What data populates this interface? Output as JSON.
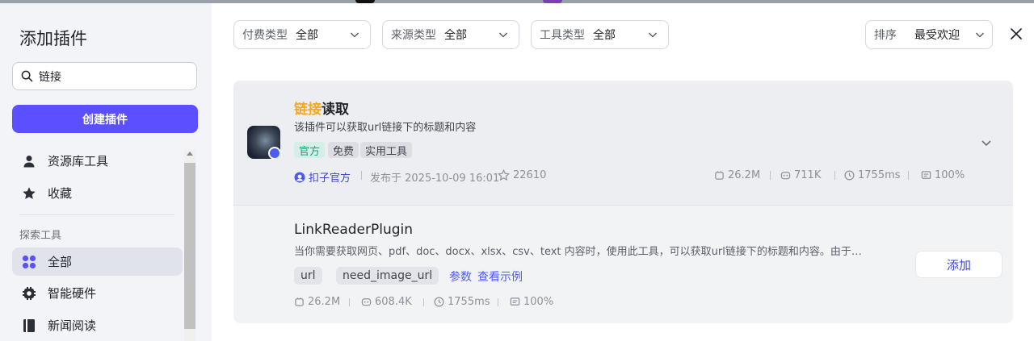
{
  "sidebar": {
    "title": "添加插件",
    "search": {
      "value": "链接",
      "placeholder": ""
    },
    "create_label": "创建插件",
    "top_items": [
      {
        "label": "资源库工具",
        "icon": "user-icon"
      },
      {
        "label": "收藏",
        "icon": "star-icon"
      }
    ],
    "section_label": "探索工具",
    "explore_items": [
      {
        "label": "全部",
        "icon": "grid-icon",
        "active": true
      },
      {
        "label": "智能硬件",
        "icon": "chip-icon",
        "active": false
      },
      {
        "label": "新闻阅读",
        "icon": "book-icon",
        "active": false
      }
    ]
  },
  "filters": [
    {
      "label": "付费类型",
      "value": "全部"
    },
    {
      "label": "来源类型",
      "value": "全部"
    },
    {
      "label": "工具类型",
      "value": "全部"
    }
  ],
  "sort": {
    "label": "排序",
    "value": "最受欢迎"
  },
  "plugin": {
    "title_highlight": "链接",
    "title_rest": "读取",
    "description": "该插件可以获取url链接下的标题和内容",
    "tags": [
      "官方",
      "免费",
      "实用工具"
    ],
    "author": "扣子官方",
    "published": "发布于 2025-10-09 16:01",
    "favorites": "22610",
    "stats": {
      "calls": "26.2M",
      "bots": "711K",
      "latency": "1755ms",
      "success": "100%"
    }
  },
  "tool": {
    "name": "LinkReaderPlugin",
    "description": "当你需要获取网页、pdf、doc、docx、xlsx、csv、text 内容时，使用此工具，可以获取url链接下的标题和内容。由于…",
    "params": [
      "url",
      "need_image_url"
    ],
    "params_link": "参数",
    "example_link": "查看示例",
    "stats": {
      "calls": "26.2M",
      "bots": "608.4K",
      "latency": "1755ms",
      "success": "100%"
    },
    "add_label": "添加"
  },
  "colors": {
    "accent": "#5b4fff",
    "highlight": "#f5a623",
    "link": "#4e5bf2",
    "official_tag": "#10a37f"
  }
}
